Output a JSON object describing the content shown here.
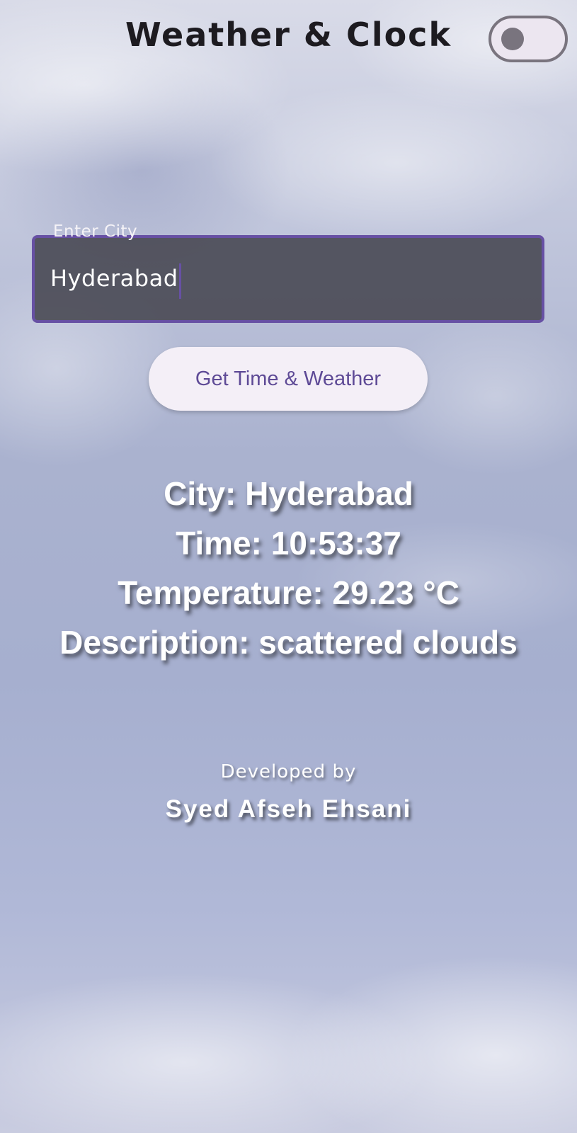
{
  "app": {
    "title": "Weather & Clock",
    "theme_toggle_on": false
  },
  "city_field": {
    "label": "Enter City",
    "value": "Hyderabad"
  },
  "action_button": {
    "label": "Get Time & Weather"
  },
  "results": {
    "city": "City: Hyderabad",
    "time": "Time: 10:53:37",
    "temperature": "Temperature: 29.23 °C",
    "description": "Description: scattered clouds"
  },
  "credits": {
    "caption": "Developed by",
    "name": "Syed Afseh Ehsani"
  },
  "colors": {
    "accent": "#6750a4",
    "button_text": "#5e4a96",
    "button_bg": "#f4eff7",
    "title": "#1d1b20",
    "result_text": "#ffffff"
  }
}
